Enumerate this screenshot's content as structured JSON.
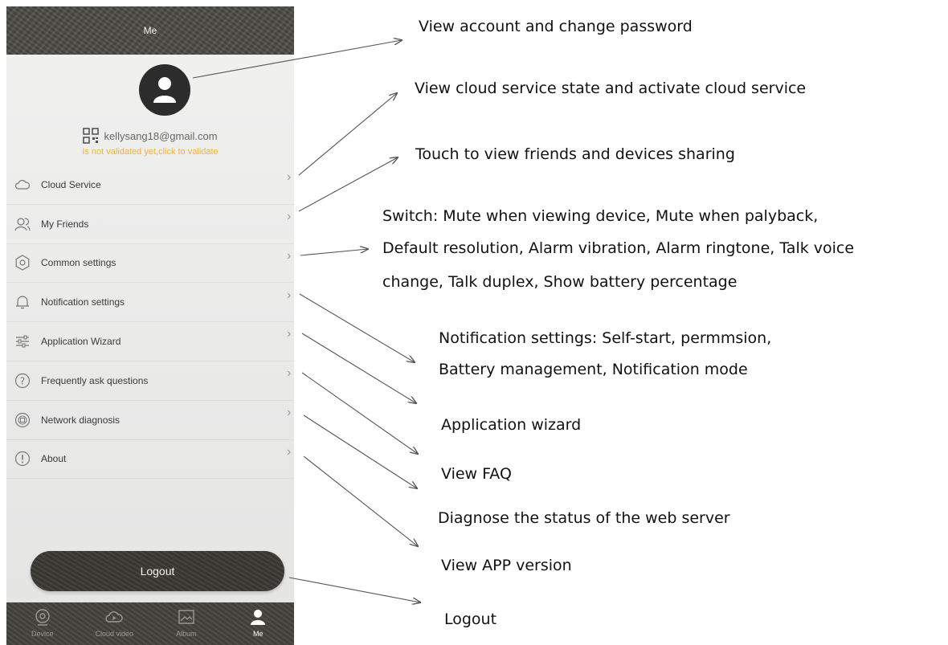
{
  "header": {
    "title": "Me"
  },
  "profile": {
    "email": "kellysang18@gmail.com",
    "validate_text": "Is not validated yet,click to validate"
  },
  "menu": [
    {
      "label": "Cloud Service",
      "icon": "cloud-icon"
    },
    {
      "label": "My Friends",
      "icon": "friends-icon"
    },
    {
      "label": "Common settings",
      "icon": "gear-icon"
    },
    {
      "label": "Notification settings",
      "icon": "bell-icon"
    },
    {
      "label": "Application Wizard",
      "icon": "sliders-icon"
    },
    {
      "label": "Frequently ask questions",
      "icon": "question-icon"
    },
    {
      "label": "Network diagnosis",
      "icon": "network-icon"
    },
    {
      "label": "About",
      "icon": "info-icon"
    }
  ],
  "logout": {
    "label": "Logout"
  },
  "tabs": [
    {
      "label": "Device",
      "icon": "device-icon"
    },
    {
      "label": "Cloud video",
      "icon": "cloud-video-icon"
    },
    {
      "label": "Album",
      "icon": "album-icon"
    },
    {
      "label": "Me",
      "icon": "person-icon",
      "active": true
    }
  ],
  "annotations": {
    "account": "View account and change password",
    "cloud": "View cloud service state and activate cloud service",
    "friends": "Touch to view friends and devices sharing",
    "switch_line1": "Switch: Mute when viewing device, Mute when palyback,",
    "switch_line2": "Default resolution, Alarm vibration, Alarm ringtone, Talk voice",
    "switch_line3": "change, Talk  duplex, Show battery percentage",
    "notif_line1": "Notification settings: Self-start, permmsion,",
    "notif_line2": "Battery management, Notification mode",
    "wizard": "Application wizard",
    "faq": "View FAQ",
    "diagnose": "Diagnose the status of the web server",
    "version": "View APP version",
    "logout": "Logout"
  },
  "colors": {
    "header_bg": "#4d4b45",
    "validate_text": "#f0b33a",
    "panel_bg": "#ececeb",
    "annotation_text": "#111111"
  }
}
